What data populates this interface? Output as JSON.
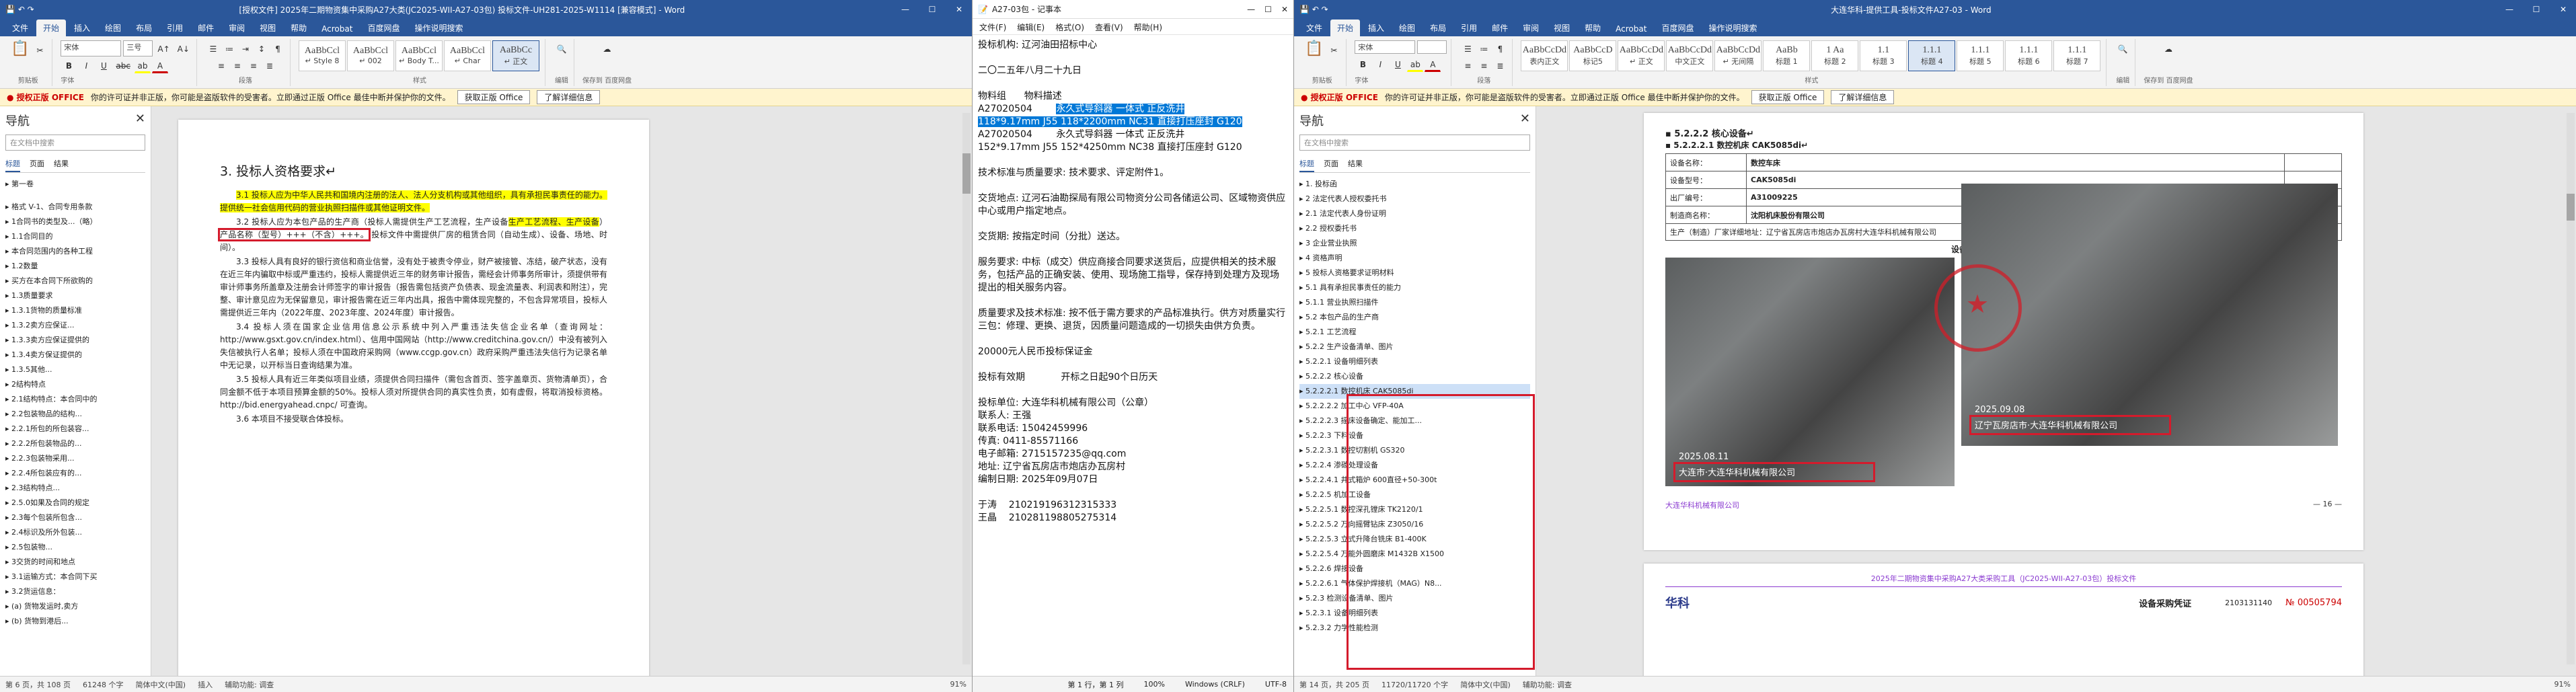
{
  "win1": {
    "title": "[授权文件] 2025年二期物资集中采购A27大类(JC2025-WII-A27-03包) 投标文件-UH281-2025-W1114 [兼容模式] - Word",
    "tabs": [
      "文件",
      "开始",
      "插入",
      "绘图",
      "布局",
      "引用",
      "邮件",
      "审阅",
      "视图",
      "帮助",
      "Acrobat",
      "百度网盘",
      "操作说明搜索"
    ],
    "active_tab": "开始",
    "font_name": "宋体",
    "font_size": "三号",
    "styles": [
      {
        "sample": "AaBbCcl",
        "label": "↵ Style 8"
      },
      {
        "sample": "AaBbCcl",
        "label": "↵ 002"
      },
      {
        "sample": "AaBbCcl",
        "label": "↵ Body T..."
      },
      {
        "sample": "AaBbCcl",
        "label": "↵ Char"
      },
      {
        "sample": "AaBbCc",
        "label": "↵ 正文"
      }
    ],
    "groups": [
      "剪贴板",
      "字体",
      "段落",
      "样式",
      "编辑",
      "保存到 百度网盘"
    ],
    "notice": {
      "warn": "● 授权正版 OFFICE",
      "text": "你的许可证并非正版，你可能是盗版软件的受害者。立即通过正版 Office 最佳中断并保护你的文件。",
      "btn1": "获取正版 Office",
      "btn2": "了解详细信息"
    },
    "nav": {
      "title": "导航",
      "search": "在文档中搜索",
      "tabs": [
        "标题",
        "页面",
        "结果"
      ],
      "items": [
        {
          "t": "第一卷",
          "l": "l1"
        },
        {
          "t": "",
          "l": "l1"
        },
        {
          "t": "",
          "l": "l1"
        },
        {
          "t": "格式 V-1、合同专用条款",
          "l": "l1"
        },
        {
          "t": "1合同书的类型及...（略）",
          "l": "l1"
        },
        {
          "t": "1.1合同目的",
          "l": "l2"
        },
        {
          "t": "本合同范围内的各种工程",
          "l": "l3"
        },
        {
          "t": "1.2数量",
          "l": "l2"
        },
        {
          "t": "买方在本合同下所欲购的",
          "l": "l3"
        },
        {
          "t": "1.3质量要求",
          "l": "l2"
        },
        {
          "t": "1.3.1货物的质量标准",
          "l": "l3"
        },
        {
          "t": "1.3.2卖方应保证...",
          "l": "l3"
        },
        {
          "t": "1.3.3卖方应保证提供的",
          "l": "l3"
        },
        {
          "t": "1.3.4卖方保证提供的",
          "l": "l3"
        },
        {
          "t": "1.3.5其他...",
          "l": "l3"
        },
        {
          "t": "2结构特点",
          "l": "l1"
        },
        {
          "t": "2.1结构特点：本合同中的",
          "l": "l2"
        },
        {
          "t": "2.2包装物品的结构...",
          "l": "l2"
        },
        {
          "t": "2.2.1所包的所包装容...",
          "l": "l3"
        },
        {
          "t": "2.2.2所包装物品的...",
          "l": "l3"
        },
        {
          "t": "2.2.3包装物采用...",
          "l": "l3"
        },
        {
          "t": "2.2.4所包装应有的...",
          "l": "l3"
        },
        {
          "t": "2.3结构特点...",
          "l": "l2"
        },
        {
          "t": "2.5.0如果及合同的规定",
          "l": "l3"
        },
        {
          "t": "2.3每个包装所包含...",
          "l": "l3"
        },
        {
          "t": "2.4标识及所外包装...",
          "l": "l3"
        },
        {
          "t": "2.5包装物...",
          "l": "l3"
        },
        {
          "t": "3交货的时间和地点",
          "l": "l1"
        },
        {
          "t": "3.1运输方式：本合同下买",
          "l": "l2"
        },
        {
          "t": "3.2货运信息：",
          "l": "l2"
        },
        {
          "t": "(a) 货物发运时,卖方",
          "l": "l3"
        },
        {
          "t": "(b) 货物到港后...",
          "l": "l3"
        }
      ]
    },
    "doc": {
      "heading": "3. 投标人资格要求↵",
      "p1": "3.1 投标人应为中华人民共和国境内注册的法人、法人分支机构或其他组织，具有承担民事责任的能力。提供统一社会信用代码的营业执照扫描件或其他证明文件。",
      "p2a": "3.2 投标人应为本包产品的生产商（投标人需提供生产工艺流程，生产设备",
      "p2b": "）",
      "p2box": "产品名称（型号）+++（不含）+++。",
      "p2c": "投标文件中需提供厂房的租赁合同（自动生成）、设备、场地、时间）。",
      "p3": "3.3 投标人具有良好的银行资信和商业信誉，没有处于被责令停业，财产被接管、冻结，破产状态，没有在近三年内骗取中标或严重违约，投标人需提供近三年的财务审计报告，需经会计师事务所审计，须提供带有审计师事务所盖章及注册会计师签字的审计报告（报告需包括资产负债表、现金流量表、利润表和附注），完整、审计意见应为无保留意见，审计报告需在近三年内出具，报告中需体现完整的，不包含异常项目，投标人需提供近三年内（2022年度、2023年度、2024年度）审计报告。",
      "p4": "3.4 投标人须在国家企业信用信息公示系统中列入严重违法失信企业名单（查询网址：http://www.gsxt.gov.cn/index.html）、信用中国网站（http://www.creditchina.gov.cn/）中没有被列入失信被执行人名单；投标人须在中国政府采购网（www.ccgp.gov.cn）政府采购严重违法失信行为记录名单中无记录，以开标当日查询结果为准。",
      "p5": "3.5 投标人具有近三年类似项目业绩，须提供合同扫描件（需包含首页、签字盖章页、货物清单页），合同金额不低于本项目预算金额的50%。投标人须对所提供合同的真实性负责，如有虚假，将取消投标资格。http://bid.energyahead.cnpc/ 可查询。",
      "p6": "3.6 本项目不接受联合体投标。"
    },
    "status": {
      "page": "第 6 页，共 108 页",
      "words": "61248 个字",
      "lang": "简体中文(中国)",
      "mode": "插入",
      "accessibility": "辅助功能: 调查",
      "zoom": "91%"
    }
  },
  "win2": {
    "title": "A27-03包 - 记事本",
    "menu": [
      "文件(F)",
      "编辑(E)",
      "格式(O)",
      "查看(V)",
      "帮助(H)"
    ],
    "lines": [
      {
        "t": "投标机构: 辽河油田招标中心"
      },
      {
        "t": ""
      },
      {
        "t": "二〇二五年八月二十九日"
      },
      {
        "t": ""
      },
      {
        "t": "物料组      物料描述"
      },
      {
        "t": "A27020504        ",
        "sel": "永久式导斜器 一体式 正反洗井"
      },
      {
        "t": "",
        "sel": "118*9.17mm J55 118*2200mm NC31 直接打压座封 G120"
      },
      {
        "t": "A27020504        永久式导斜器 一体式 正反洗井"
      },
      {
        "t": "152*9.17mm J55 152*4250mm NC38 直接打压座封 G120"
      },
      {
        "t": ""
      },
      {
        "t": "技术标准与质量要求: 技术要求、评定附件1。"
      },
      {
        "t": ""
      },
      {
        "t": "交货地点: 辽河石油勘探局有限公司物资分公司各储运公司、区域物资供应中心或用户指定地点。"
      },
      {
        "t": ""
      },
      {
        "t": "交货期: 按指定时间（分批）送达。"
      },
      {
        "t": ""
      },
      {
        "t": "服务要求: 中标（成交）供应商接合同要求送货后，应提供相关的技术服务，包括产品的正确安装、使用、现场施工指导，保存持到处理方及现场提出的相关服务内容。"
      },
      {
        "t": ""
      },
      {
        "t": "质量要求及技术标准: 按不低于需方要求的产品标准执行。供方对质量实行三包：修理、更换、退货，因质量问题造成的一切损失由供方负责。"
      },
      {
        "t": ""
      },
      {
        "t": "20000元人民币投标保证金"
      },
      {
        "t": ""
      },
      {
        "t": "投标有效期            开标之日起90个日历天"
      },
      {
        "t": ""
      },
      {
        "t": "投标单位: 大连华科机械有限公司（公章）"
      },
      {
        "t": "联系人: 王强"
      },
      {
        "t": "联系电话: 15042459996"
      },
      {
        "t": "传真: 0411-85571166"
      },
      {
        "t": "电子邮箱: 2715157235@qq.com"
      },
      {
        "t": "地址: 辽宁省瓦房店市炮店办瓦房村"
      },
      {
        "t": "编制日期: 2025年09月07日"
      },
      {
        "t": ""
      },
      {
        "t": "于涛    210219196312315333"
      },
      {
        "t": "王晶    210281198805275314"
      }
    ],
    "status": {
      "pos": "第 1 行，第 1 列",
      "zoom": "100%",
      "eol": "Windows (CRLF)",
      "enc": "UTF-8"
    }
  },
  "win3": {
    "title": "大连华科-提供工具-投标文件A27-03 - Word",
    "tabs": [
      "文件",
      "开始",
      "插入",
      "绘图",
      "布局",
      "引用",
      "邮件",
      "审阅",
      "视图",
      "帮助",
      "Acrobat",
      "百度网盘",
      "操作说明搜索"
    ],
    "active_tab": "开始",
    "styles": [
      {
        "sample": "AaBbCcDd",
        "label": "表内正文"
      },
      {
        "sample": "AaBbCcD",
        "label": "标记5"
      },
      {
        "sample": "AaBbCcDd",
        "label": "↵ 正文"
      },
      {
        "sample": "AaBbCcDd",
        "label": "中文正文"
      },
      {
        "sample": "AaBbCcDd",
        "label": "↵ 无间隔"
      },
      {
        "sample": "AaBb",
        "label": "标题 1"
      },
      {
        "sample": "1  Aa",
        "label": "标题 2"
      },
      {
        "sample": "1.1",
        "label": "标题 3"
      },
      {
        "sample": "1.1.1",
        "label": "标题 4"
      },
      {
        "sample": "1.1.1",
        "label": "标题 5"
      },
      {
        "sample": "1.1.1",
        "label": "标题 6"
      },
      {
        "sample": "1.1.1",
        "label": "标题 7"
      }
    ],
    "notice": {
      "warn": "● 授权正版 OFFICE",
      "text": "你的许可证并非正版，你可能是盗版软件的受害者。立即通过正版 Office 最佳中断并保护你的文件。",
      "btn1": "获取正版 Office",
      "btn2": "了解详细信息"
    },
    "nav": {
      "title": "导航",
      "search": "在文档中搜索",
      "tabs": [
        "标题",
        "页面",
        "结果"
      ],
      "items": [
        {
          "t": "1. 投标函",
          "l": "l2"
        },
        {
          "t": "2 法定代表人授权委托书",
          "l": "l2"
        },
        {
          "t": "2.1 法定代表人身份证明",
          "l": "l3"
        },
        {
          "t": "2.2 授权委托书",
          "l": "l3"
        },
        {
          "t": "3 企业营业执照",
          "l": "l2"
        },
        {
          "t": "4 资格声明",
          "l": "l2"
        },
        {
          "t": "5 投标人资格要求证明材料",
          "l": "l2"
        },
        {
          "t": "5.1 具有承担民事责任的能力",
          "l": "l3"
        },
        {
          "t": "5.1.1 营业执照扫描件",
          "l": "l4"
        },
        {
          "t": "5.2 本包产品的生产商",
          "l": "l3"
        },
        {
          "t": "5.2.1 工艺流程",
          "l": "l4"
        },
        {
          "t": "5.2.2 生产设备清单、图片",
          "l": "l4"
        },
        {
          "t": "5.2.2.1 设备明细列表",
          "l": "l5"
        },
        {
          "t": "5.2.2.2 核心设备",
          "l": "l5"
        },
        {
          "t": "5.2.2.2.1 数控机床 CAK5085di",
          "l": "l5",
          "sel": true
        },
        {
          "t": "5.2.2.2.2 加工中心 VFP-40A",
          "l": "l5"
        },
        {
          "t": "5.2.2.2.3 摇床设备确定、能加工...",
          "l": "l5"
        },
        {
          "t": "5.2.2.3 下料设备",
          "l": "l4"
        },
        {
          "t": "5.2.2.3.1 数控切割机 GS320",
          "l": "l5"
        },
        {
          "t": "5.2.2.4 渗碳处理设备",
          "l": "l4"
        },
        {
          "t": "5.2.2.4.1 井式箱炉 600直径+50-300t",
          "l": "l5"
        },
        {
          "t": "5.2.2.5 机加工设备",
          "l": "l4"
        },
        {
          "t": "5.2.2.5.1 数控深孔镗床 TK2120/1",
          "l": "l5"
        },
        {
          "t": "5.2.2.5.2 万向摇臂钻床 Z3050/16",
          "l": "l5"
        },
        {
          "t": "5.2.2.5.3 立式升降台铣床 B1-400K",
          "l": "l5"
        },
        {
          "t": "5.2.2.5.4 万能外圆磨床 M1432B X1500",
          "l": "l5"
        },
        {
          "t": "5.2.2.6 焊接设备",
          "l": "l4"
        },
        {
          "t": "5.2.2.6.1 气体保护焊接机（MAG）N8...",
          "l": "l5"
        },
        {
          "t": "5.2.3 检测设备清单、图片",
          "l": "l3"
        },
        {
          "t": "5.2.3.1 设备明细列表",
          "l": "l4"
        },
        {
          "t": "5.2.3.2 力学性能检测",
          "l": "l4"
        }
      ]
    },
    "doc": {
      "h1": "▪ 5.2.2.2 核心设备↵",
      "h2": "▪ 5.2.2.2.1 数控机床 CAK5085di↵",
      "rows": [
        {
          "k": "设备名称：",
          "v": "数控车床"
        },
        {
          "k": "设备型号：",
          "v": "CAK5085di"
        },
        {
          "k": "出厂编号：",
          "v": "A31009225"
        },
        {
          "k": "制造商名称：",
          "v": "沈阳机床股份有限公司"
        }
      ],
      "line5": "生产（制造）厂家详细地址：辽宁省瓦房店市炮店办瓦房村大连华科机械有限公司",
      "photo_title": "设备：自有工厂现场布置图片",
      "photo1_date": "2025.08.11",
      "photo1_cap": "大连市·大连华科机械有限公司",
      "photo2_date": "2025.09.08",
      "photo2_cap": "辽宁瓦房店市·大连华科机械有限公司",
      "footer_left": "大连华科机械有限公司",
      "footer_right": "— 16 —",
      "p2_header": "2025年二期物资集中采购A27大类采购工具（JC2025-WII-A27-03包）投标文件",
      "p2_logo": "华科",
      "p2_title": "设备采购凭证",
      "p2_num": "№ 00505794",
      "p2_code": "2103131140"
    },
    "status": {
      "page": "第 14 页，共 205 页",
      "words": "11720/11720 个字",
      "lang": "简体中文(中国)",
      "accessibility": "辅助功能: 调查",
      "zoom": "91%"
    }
  }
}
